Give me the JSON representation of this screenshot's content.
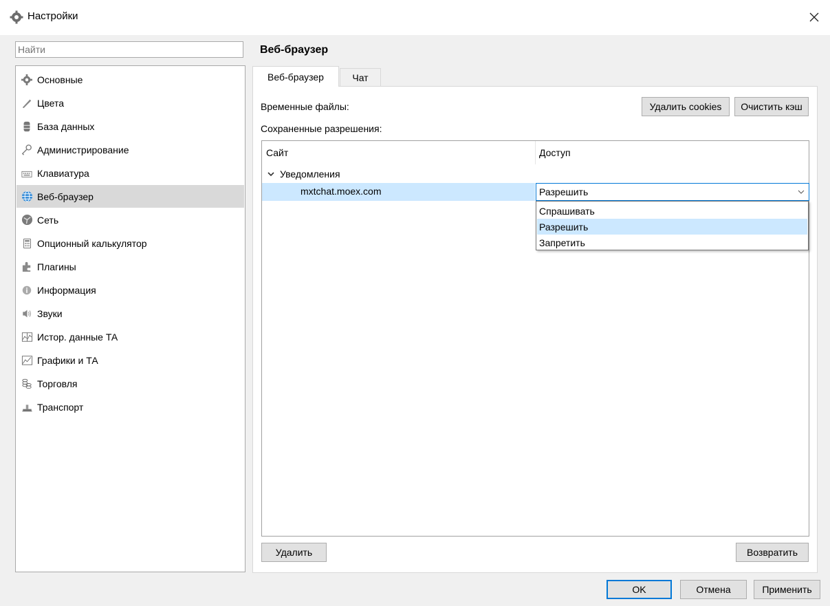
{
  "window": {
    "title": "Настройки"
  },
  "search": {
    "placeholder": "Найти"
  },
  "sidebar": {
    "items": [
      {
        "label": "Основные",
        "icon": "gear-icon"
      },
      {
        "label": "Цвета",
        "icon": "brush-icon"
      },
      {
        "label": "База данных",
        "icon": "database-icon"
      },
      {
        "label": "Администрирование",
        "icon": "key-icon"
      },
      {
        "label": "Клавиатура",
        "icon": "keyboard-icon"
      },
      {
        "label": "Веб-браузер",
        "icon": "globe-icon",
        "active": true
      },
      {
        "label": "Сеть",
        "icon": "network-icon"
      },
      {
        "label": "Опционный калькулятор",
        "icon": "calculator-icon"
      },
      {
        "label": "Плагины",
        "icon": "puzzle-icon"
      },
      {
        "label": "Информация",
        "icon": "info-icon"
      },
      {
        "label": "Звуки",
        "icon": "speaker-icon"
      },
      {
        "label": "Истор. данные ТА",
        "icon": "history-chart-icon"
      },
      {
        "label": "Графики и ТА",
        "icon": "line-chart-icon"
      },
      {
        "label": "Торговля",
        "icon": "coins-icon"
      },
      {
        "label": "Транспорт",
        "icon": "transport-icon"
      }
    ]
  },
  "panel": {
    "title": "Веб-браузер",
    "tabs": [
      {
        "label": "Веб-браузер",
        "active": true
      },
      {
        "label": "Чат",
        "active": false
      }
    ],
    "temp_files_label": "Временные файлы:",
    "delete_cookies": "Удалить cookies",
    "clear_cache": "Очистить кэш",
    "saved_permissions_label": "Сохраненные разрешения:",
    "table": {
      "columns": [
        "Сайт",
        "Доступ"
      ],
      "group": "Уведомления",
      "site": "mxtchat.moex.com",
      "access_value": "Разрешить",
      "options": [
        "Спрашивать",
        "Разрешить",
        "Запретить"
      ],
      "selected_option_index": 1
    },
    "delete_button": "Удалить",
    "restore_button": "Возвратить"
  },
  "footer": {
    "ok": "OK",
    "cancel": "Отмена",
    "apply": "Применить"
  },
  "colors": {
    "selection": "#cce8ff",
    "accent": "#0078d7",
    "sidebar_active": "#d9d9d9"
  }
}
